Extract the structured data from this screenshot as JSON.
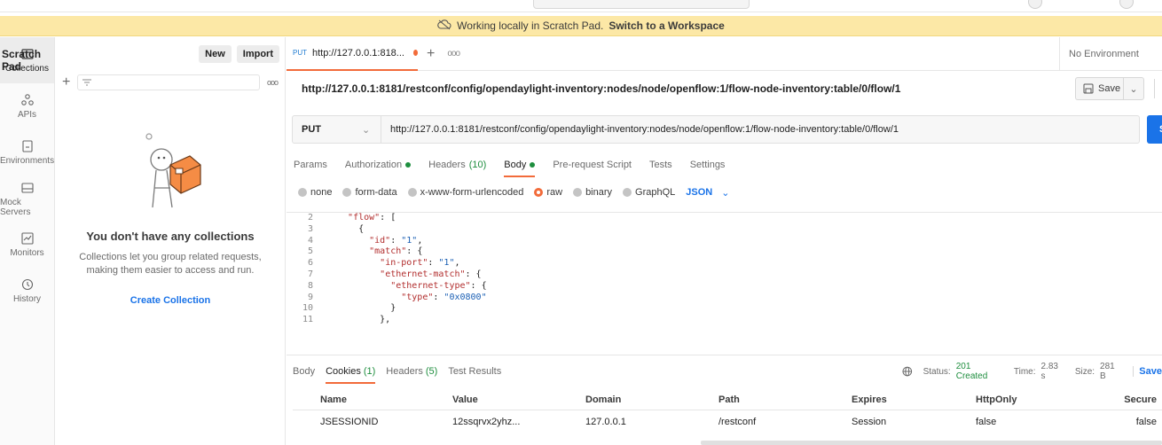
{
  "banner": {
    "text": "Working locally in Scratch Pad.",
    "link": "Switch to a Workspace"
  },
  "sidebar": {
    "title": "Scratch Pad",
    "new_label": "New",
    "import_label": "Import",
    "rail": [
      {
        "label": "Collections",
        "icon": "collections-icon"
      },
      {
        "label": "APIs",
        "icon": "apis-icon"
      },
      {
        "label": "Environments",
        "icon": "environments-icon"
      },
      {
        "label": "Mock Servers",
        "icon": "mock-servers-icon"
      },
      {
        "label": "Monitors",
        "icon": "monitors-icon"
      },
      {
        "label": "History",
        "icon": "history-icon"
      }
    ],
    "empty_title": "You don't have any collections",
    "empty_desc": "Collections let you group related requests, making them easier to access and run.",
    "create_label": "Create Collection"
  },
  "tab": {
    "method": "PUT",
    "label": "http://127.0.0.1:818..."
  },
  "environment": "No Environment",
  "request": {
    "title": "http://127.0.0.1:8181/restconf/config/opendaylight-inventory:nodes/node/openflow:1/flow-node-inventory:table/0/flow/1",
    "method": "PUT",
    "url": "http://127.0.0.1:8181/restconf/config/opendaylight-inventory:nodes/node/openflow:1/flow-node-inventory:table/0/flow/1",
    "save_label": "Save",
    "send_label": "S",
    "tabs": [
      "Params",
      "Authorization",
      "Headers",
      "(10)",
      "Body",
      "Pre-request Script",
      "Tests",
      "Settings"
    ],
    "body_types": [
      "none",
      "form-data",
      "x-www-form-urlencoded",
      "raw",
      "binary",
      "GraphQL"
    ],
    "language": "JSON"
  },
  "editor": {
    "lines": [
      {
        "n": "2",
        "parts": [
          [
            "p",
            "  "
          ],
          [
            "k",
            "\"flow\""
          ],
          [
            "p",
            ": ["
          ]
        ]
      },
      {
        "n": "3",
        "parts": [
          [
            "p",
            "    {"
          ]
        ]
      },
      {
        "n": "4",
        "parts": [
          [
            "p",
            "      "
          ],
          [
            "k",
            "\"id\""
          ],
          [
            "p",
            ": "
          ],
          [
            "s",
            "\"1\""
          ],
          [
            "p",
            ","
          ]
        ]
      },
      {
        "n": "5",
        "parts": [
          [
            "p",
            "      "
          ],
          [
            "k",
            "\"match\""
          ],
          [
            "p",
            ": {"
          ]
        ]
      },
      {
        "n": "6",
        "parts": [
          [
            "p",
            "        "
          ],
          [
            "k",
            "\"in-port\""
          ],
          [
            "p",
            ": "
          ],
          [
            "s",
            "\"1\""
          ],
          [
            "p",
            ","
          ]
        ]
      },
      {
        "n": "7",
        "parts": [
          [
            "p",
            "        "
          ],
          [
            "k",
            "\"ethernet-match\""
          ],
          [
            "p",
            ": {"
          ]
        ]
      },
      {
        "n": "8",
        "parts": [
          [
            "p",
            "          "
          ],
          [
            "k",
            "\"ethernet-type\""
          ],
          [
            "p",
            ": {"
          ]
        ]
      },
      {
        "n": "9",
        "parts": [
          [
            "p",
            "            "
          ],
          [
            "k",
            "\"type\""
          ],
          [
            "p",
            ": "
          ],
          [
            "s",
            "\"0x0800\""
          ]
        ]
      },
      {
        "n": "10",
        "parts": [
          [
            "p",
            "          }"
          ]
        ]
      },
      {
        "n": "11",
        "parts": [
          [
            "p",
            "        },"
          ]
        ]
      }
    ]
  },
  "response": {
    "tabs": [
      "Body",
      "Cookies",
      "(1)",
      "Headers",
      "(5)",
      "Test Results"
    ],
    "status_label": "Status:",
    "status": "201 Created",
    "time_label": "Time:",
    "time": "2.83 s",
    "size_label": "Size:",
    "size": "281 B",
    "save_label": "Save"
  },
  "cookies": {
    "headers": [
      "Name",
      "Value",
      "Domain",
      "Path",
      "Expires",
      "HttpOnly",
      "Secure"
    ],
    "rows": [
      [
        "JSESSIONID",
        "12ssqrvx2yhz...",
        "127.0.0.1",
        "/restconf",
        "Session",
        "false",
        "false"
      ]
    ]
  }
}
